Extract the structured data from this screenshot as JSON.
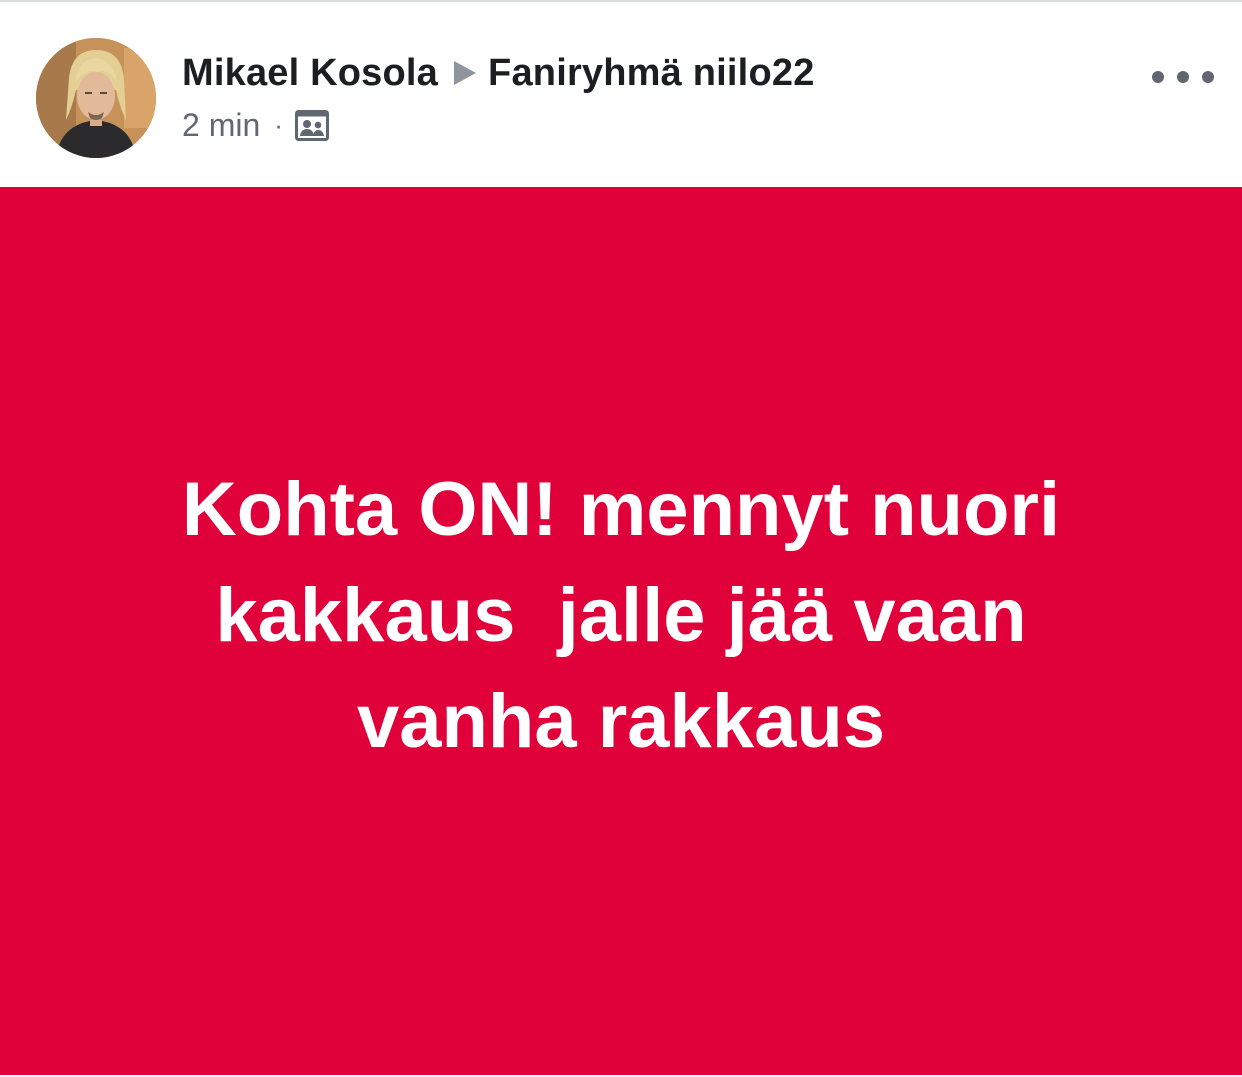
{
  "post": {
    "author": "Mikael Kosola",
    "group": "Faniryhmä niilo22",
    "timestamp": "2 min",
    "separator": "·",
    "privacy_icon": "group-icon",
    "more_icon": "more-options-icon",
    "body_text": "Kohta ON! mennyt nuori\nkakkaus  jalle jää vaan\nvanha rakkaus",
    "background_color": "#e0003a",
    "text_color": "#ffffff"
  }
}
